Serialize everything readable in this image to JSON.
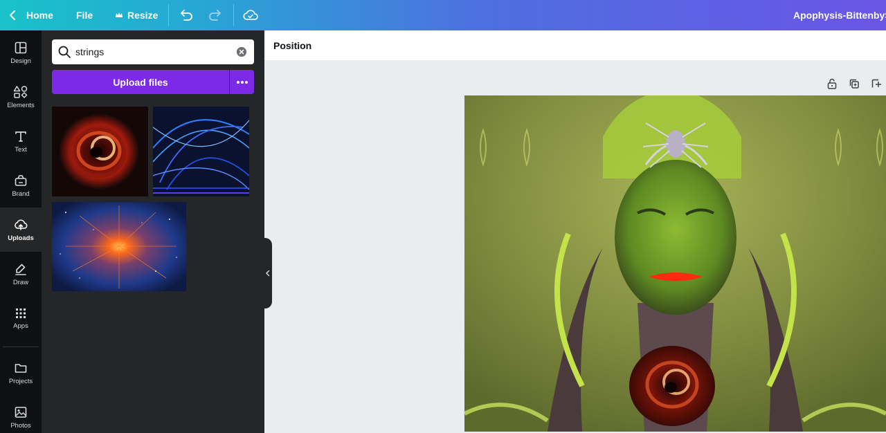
{
  "topbar": {
    "home_label": "Home",
    "file_label": "File",
    "resize_label": "Resize",
    "document_title": "Apophysis-BittenbySp"
  },
  "rail": {
    "items": [
      {
        "label": "Design",
        "icon": "layout-icon"
      },
      {
        "label": "Elements",
        "icon": "shapes-icon"
      },
      {
        "label": "Text",
        "icon": "text-icon"
      },
      {
        "label": "Brand",
        "icon": "brand-kit-icon"
      },
      {
        "label": "Uploads",
        "icon": "cloud-upload-icon",
        "active": true
      },
      {
        "label": "Draw",
        "icon": "pen-icon"
      },
      {
        "label": "Apps",
        "icon": "apps-grid-icon"
      },
      {
        "label": "Projects",
        "icon": "folder-icon"
      },
      {
        "label": "Photos",
        "icon": "photo-icon"
      }
    ]
  },
  "panel": {
    "search_value": "strings",
    "upload_label": "Upload files"
  },
  "context_bar": {
    "position_label": "Position"
  },
  "colors": {
    "accent": "#7d2ae8",
    "rail_bg": "#0f1012",
    "panel_bg": "#252627",
    "canvas_bg": "#ebecf0"
  }
}
